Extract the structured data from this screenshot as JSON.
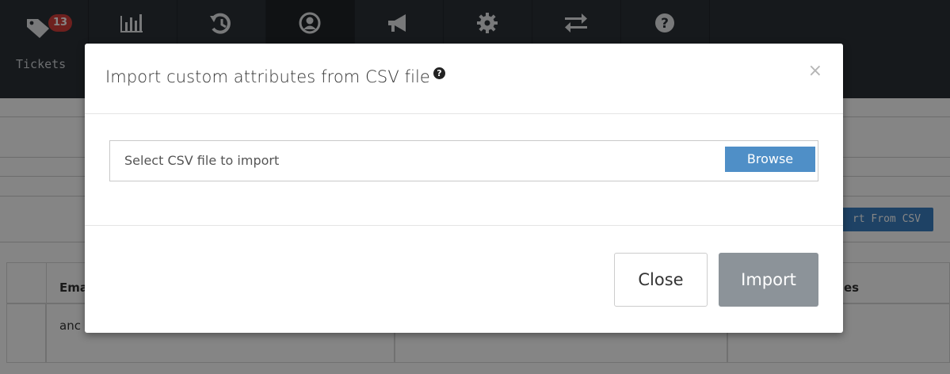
{
  "nav": {
    "tickets_label": "Tickets",
    "tickets_badge": "13",
    "icons": [
      "tag-icon",
      "bar-chart-icon",
      "history-icon",
      "user-circle-icon",
      "megaphone-icon",
      "gear-icon",
      "transfer-arrows-icon",
      "question-circle-icon"
    ]
  },
  "background": {
    "import_from_csv_label": "rt From CSV",
    "table": {
      "header_left": "Ema",
      "header_right": "es",
      "row1_left": "anc"
    }
  },
  "modal": {
    "title": "Import custom attributes from CSV file",
    "help_glyph": "?",
    "close_glyph": "×",
    "file_placeholder": "Select CSV file to import",
    "browse_label": "Browse",
    "close_button": "Close",
    "import_button": "Import"
  },
  "colors": {
    "nav_bg": "#2b3037",
    "badge": "#d43f3a",
    "browse": "#4f8fc7",
    "import_disabled": "#8c9399",
    "primary": "#3a7fc1"
  }
}
